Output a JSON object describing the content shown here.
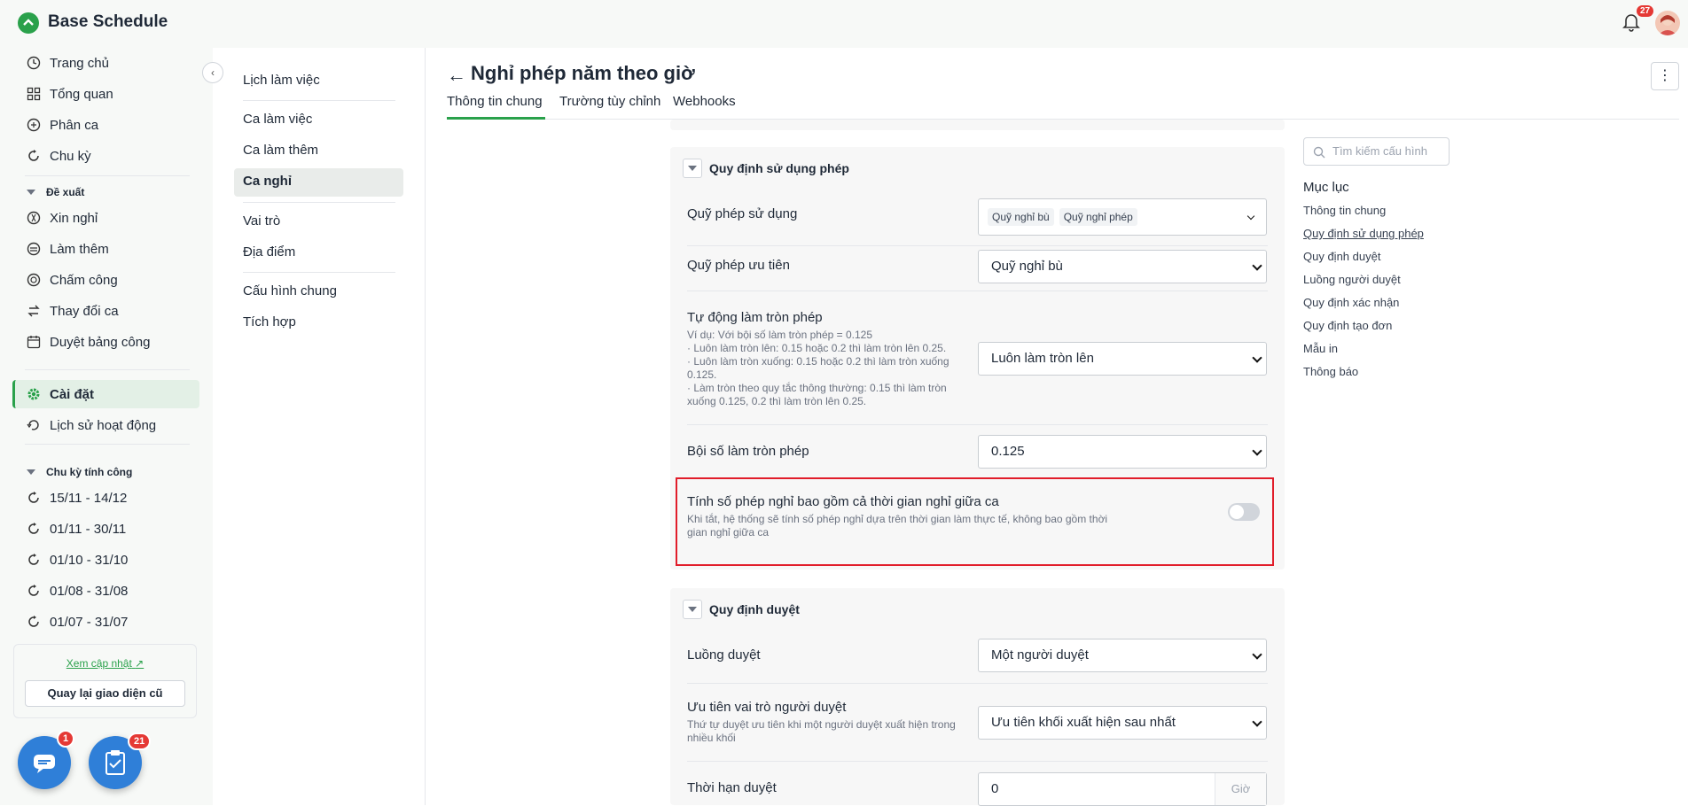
{
  "app": {
    "title": "Base Schedule",
    "notification_count": "27"
  },
  "sidebar": {
    "items": [
      {
        "label": "Trang chủ",
        "icon": "clock-icon"
      },
      {
        "label": "Tổng quan",
        "icon": "grid-icon"
      },
      {
        "label": "Phân ca",
        "icon": "shift-icon"
      },
      {
        "label": "Chu kỳ",
        "icon": "cycle-icon"
      }
    ],
    "section_proposal": "Đề xuất",
    "proposal_items": [
      {
        "label": "Xin nghỉ"
      },
      {
        "label": "Làm thêm"
      },
      {
        "label": "Chấm công"
      },
      {
        "label": "Thay đổi ca"
      },
      {
        "label": "Duyệt bảng công"
      }
    ],
    "settings": "Cài đặt",
    "history": "Lịch sử hoạt động",
    "section_cycles": "Chu kỳ tính công",
    "cycles": [
      "15/11 - 14/12",
      "01/11 - 30/11",
      "01/10 - 31/10",
      "01/08 - 31/08",
      "01/07 - 31/07"
    ],
    "update_link": "Xem cập nhật",
    "old_ui_button": "Quay lại giao diện cũ",
    "chat_badge": "1",
    "task_badge": "21"
  },
  "subnav": {
    "items": [
      "Lịch làm việc",
      "Ca làm việc",
      "Ca làm thêm",
      "Ca nghỉ",
      "Vai trò",
      "Địa điểm",
      "Cấu hình chung",
      "Tích hợp"
    ]
  },
  "page": {
    "title": "Nghỉ phép năm theo giờ",
    "tabs": [
      "Thông tin chung",
      "Trường tùy chỉnh",
      "Webhooks"
    ]
  },
  "section1": {
    "title": "Quy định sử dụng phép",
    "rows": {
      "fund_label": "Quỹ phép sử dụng",
      "fund_chips": [
        "Quỹ nghỉ bù",
        "Quỹ nghỉ phép"
      ],
      "priority_label": "Quỹ phép ưu tiên",
      "priority_value": "Quỹ nghỉ bù",
      "round_label": "Tự động làm tròn phép",
      "round_desc": [
        "Ví dụ: Với bội số làm tròn phép = 0.125",
        "· Luôn làm tròn lên: 0.15 hoặc 0.2 thì làm tròn lên 0.25.",
        "· Luôn làm tròn xuống: 0.15 hoặc 0.2 thì làm tròn xuống",
        "0.125.",
        "· Làm tròn theo quy tắc thông thường: 0.15 thì làm tròn",
        "xuống 0.125, 0.2 thì làm tròn lên 0.25."
      ],
      "round_value": "Luôn làm tròn lên",
      "multiple_label": "Bội số làm tròn phép",
      "multiple_value": "0.125",
      "break_label": "Tính số phép nghỉ bao gồm cả thời gian nghỉ giữa ca",
      "break_desc_1": "Khi tắt, hệ thống sẽ tính số phép nghỉ dựa trên thời gian làm thực tế, không bao gồm thời",
      "break_desc_2": "gian nghỉ giữa ca",
      "break_toggle": "off"
    }
  },
  "section2": {
    "title": "Quy định duyệt",
    "flow_label": "Luồng duyệt",
    "flow_value": "Một người duyệt",
    "role_label": "Ưu tiên vai trò người duyệt",
    "role_desc_1": "Thứ tự duyệt ưu tiên khi một người duyệt xuất hiện trong",
    "role_desc_2": "nhiều khối",
    "role_value": "Ưu tiên khối xuất hiện sau nhất",
    "deadline_label": "Thời hạn duyệt",
    "deadline_value": "0",
    "deadline_unit": "Giờ"
  },
  "toc": {
    "search_placeholder": "Tìm kiếm cấu hình",
    "title": "Mục lục",
    "items": [
      "Thông tin chung",
      "Quy định sử dụng phép",
      "Quy định duyệt",
      "Luồng người duyệt",
      "Quy định xác nhận",
      "Quy định tạo đơn",
      "Mẫu in",
      "Thông báo"
    ]
  },
  "colors": {
    "accent": "#2aa14b",
    "highlight": "#e11d2a",
    "fab": "#2f7fd8"
  }
}
